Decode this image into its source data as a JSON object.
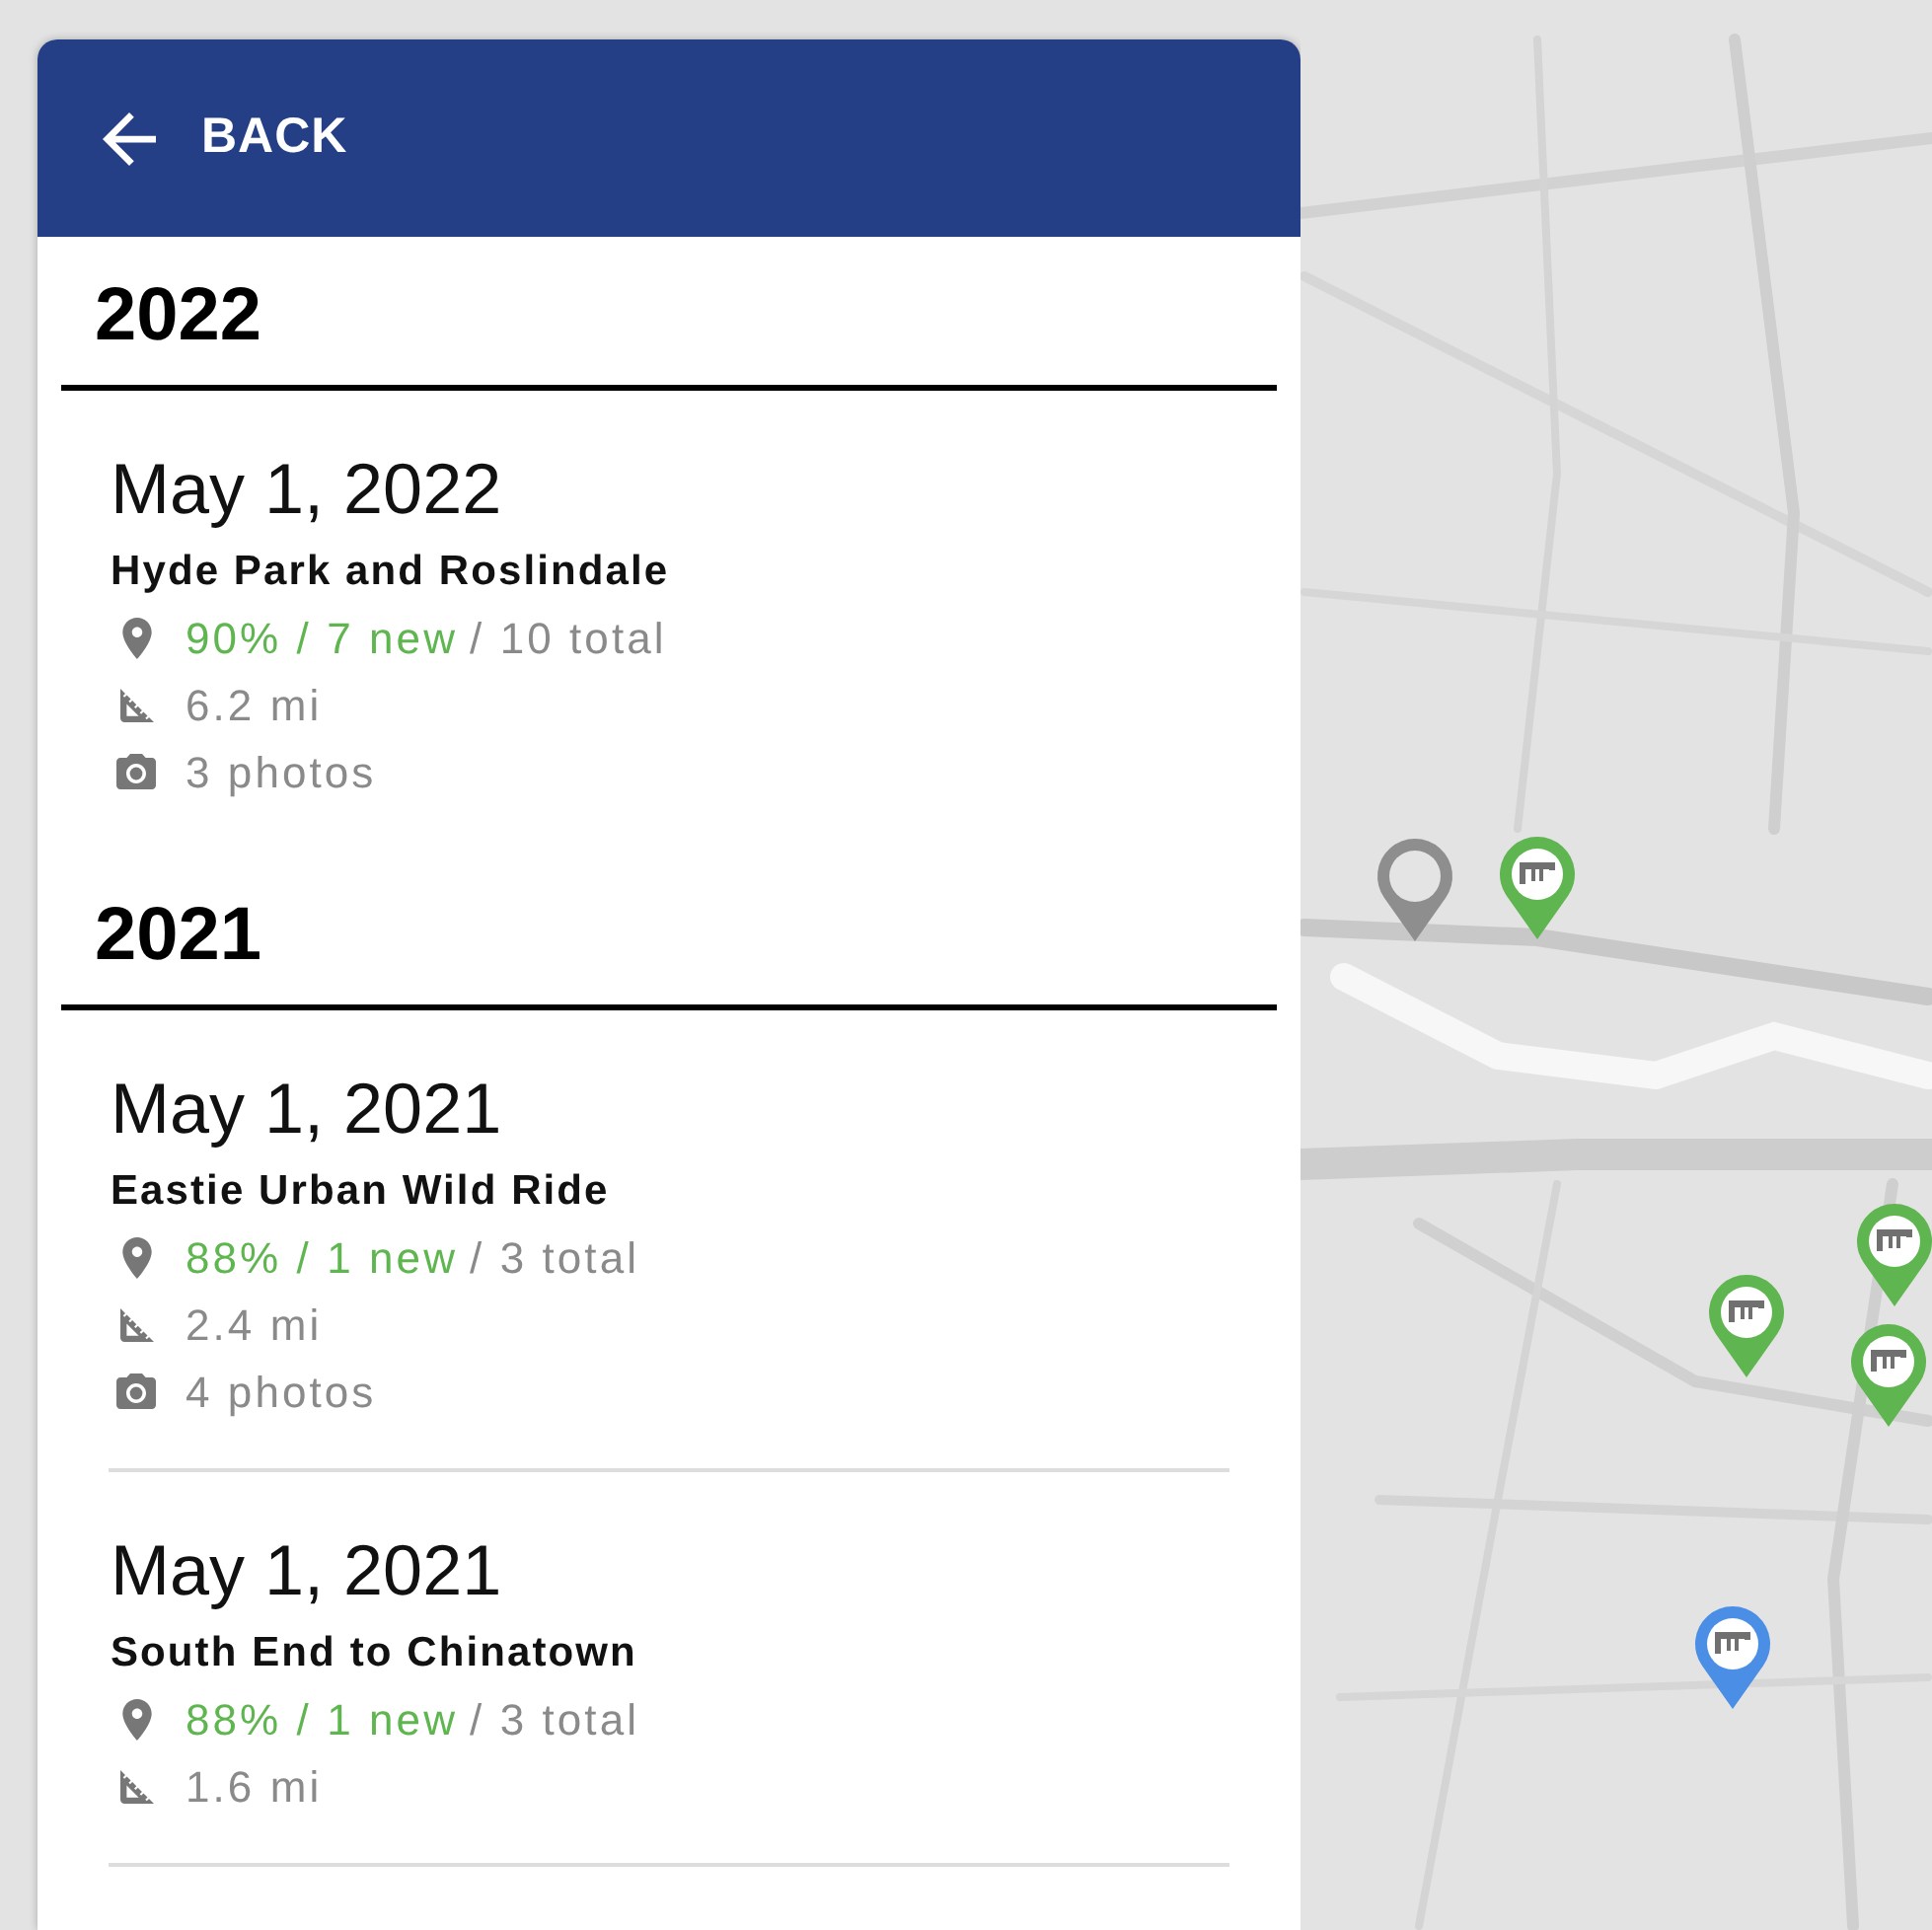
{
  "header": {
    "back_label": "BACK"
  },
  "years": [
    {
      "year": "2022",
      "rides": [
        {
          "date": "May 1, 2022",
          "title": "Hyde Park and Roslindale",
          "stats": [
            {
              "kind": "markers",
              "new": "90% / 7 new",
              "total": "/ 10 total"
            },
            {
              "kind": "distance",
              "text": "6.2 mi"
            },
            {
              "kind": "photos",
              "text": "3 photos"
            }
          ]
        }
      ]
    },
    {
      "year": "2021",
      "rides": [
        {
          "date": "May 1, 2021",
          "title": "Eastie Urban Wild Ride",
          "stats": [
            {
              "kind": "markers",
              "new": "88% / 1 new",
              "total": "/ 3 total"
            },
            {
              "kind": "distance",
              "text": "2.4 mi"
            },
            {
              "kind": "photos",
              "text": "4 photos"
            }
          ]
        },
        {
          "date": "May 1, 2021",
          "title": "South End to Chinatown",
          "stats": [
            {
              "kind": "markers",
              "new": "88% / 1 new",
              "total": "/ 3 total"
            },
            {
              "kind": "distance",
              "text": "1.6 mi"
            }
          ]
        }
      ]
    }
  ],
  "map": {
    "markers": [
      {
        "kind": "plain",
        "color": "#8e8e8e"
      },
      {
        "kind": "bridge",
        "color": "#5fb54f"
      },
      {
        "kind": "bridge",
        "color": "#5fb54f"
      },
      {
        "kind": "bridge",
        "color": "#5fb54f"
      },
      {
        "kind": "bridge",
        "color": "#5fb54f"
      },
      {
        "kind": "bridge",
        "color": "#4a8ee6"
      }
    ]
  }
}
